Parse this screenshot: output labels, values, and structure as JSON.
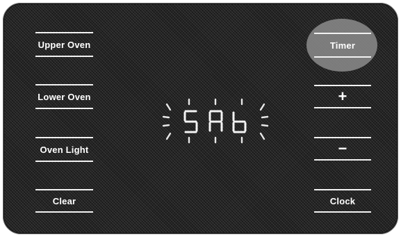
{
  "panel": {
    "left_buttons": [
      {
        "id": "upper-oven",
        "label": "Upper Oven"
      },
      {
        "id": "lower-oven",
        "label": "Lower Oven"
      },
      {
        "id": "oven-light",
        "label": "Oven Light"
      },
      {
        "id": "clear",
        "label": "Clear"
      }
    ],
    "right_buttons": [
      {
        "id": "timer",
        "label": "Timer",
        "highlighted": true
      },
      {
        "id": "plus",
        "label": "+"
      },
      {
        "id": "minus",
        "label": "−"
      },
      {
        "id": "clock",
        "label": "Clock"
      }
    ],
    "display": {
      "text": "SAb",
      "state": "flashing"
    },
    "colors": {
      "panel": "#232323",
      "text": "#ffffff",
      "highlight": "#8c8c8c"
    }
  }
}
